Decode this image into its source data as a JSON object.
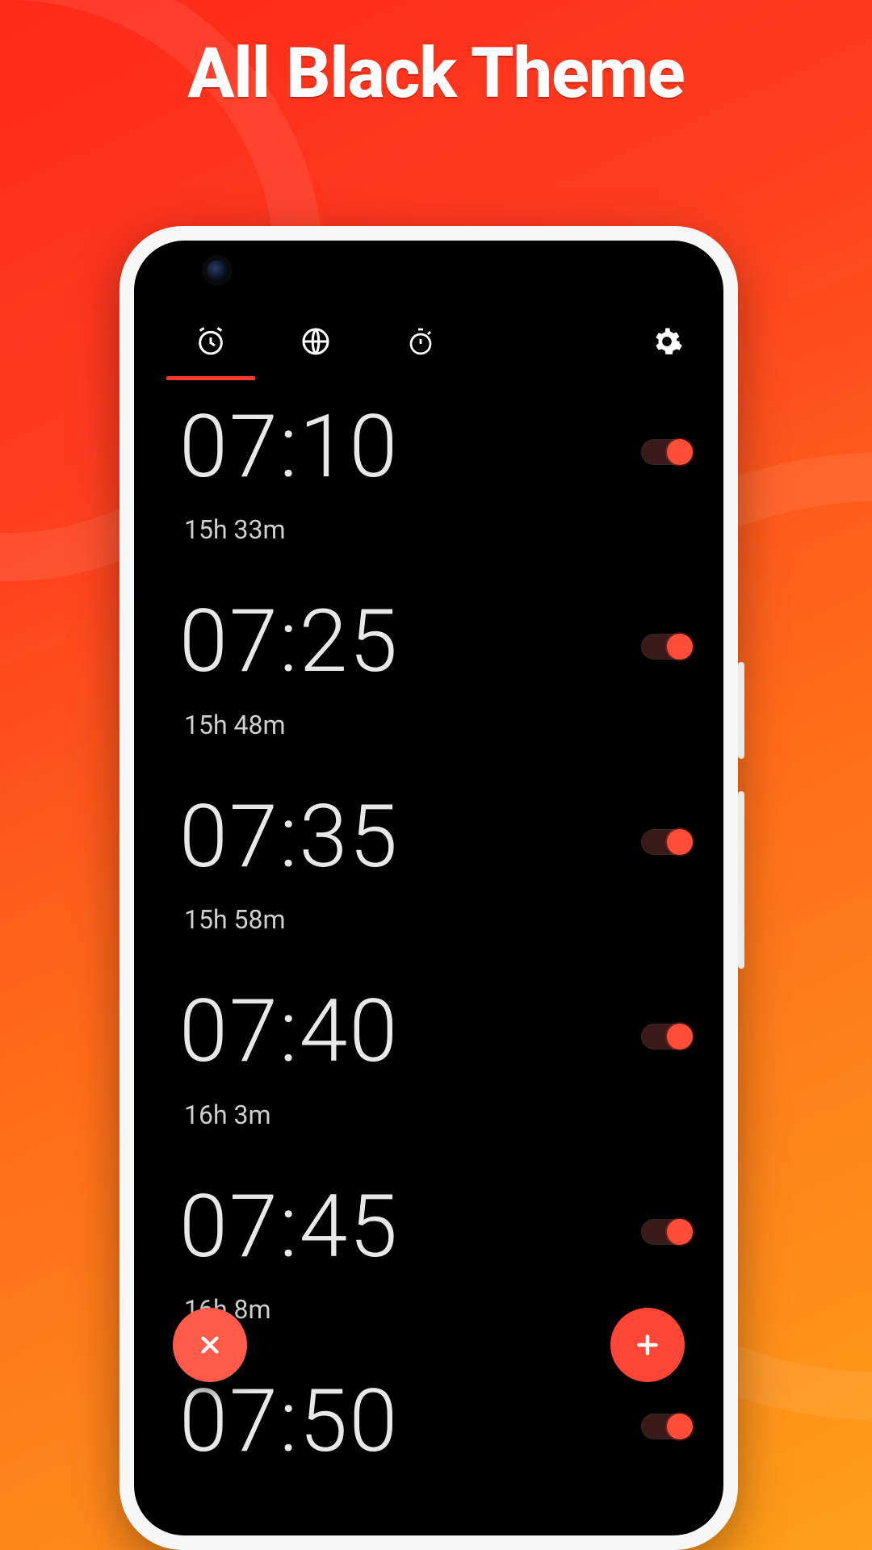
{
  "promo": {
    "title": "All Black Theme"
  },
  "tabs": {
    "active_index": 0,
    "items": [
      {
        "name": "alarm"
      },
      {
        "name": "clock"
      },
      {
        "name": "stopwatch"
      }
    ]
  },
  "settings": {
    "name": "settings"
  },
  "alarms": [
    {
      "time": "07:10",
      "remaining": "15h 33m",
      "enabled": true
    },
    {
      "time": "07:25",
      "remaining": "15h 48m",
      "enabled": true
    },
    {
      "time": "07:35",
      "remaining": "15h 58m",
      "enabled": true
    },
    {
      "time": "07:40",
      "remaining": "16h 3m",
      "enabled": true
    },
    {
      "time": "07:45",
      "remaining": "16h 8m",
      "enabled": true
    },
    {
      "time": "07:50",
      "remaining": "",
      "enabled": true
    }
  ],
  "fab": {
    "dismiss": {
      "name": "dismiss"
    },
    "add": {
      "name": "add"
    }
  },
  "colors": {
    "accent": "#ff4536",
    "bg": "#000000"
  }
}
